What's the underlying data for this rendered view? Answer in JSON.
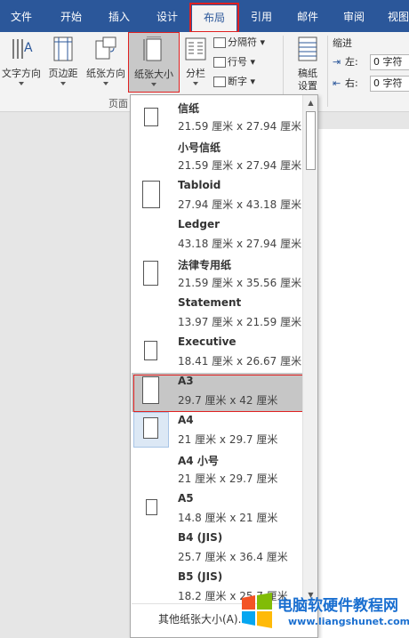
{
  "tabs": [
    "文件",
    "开始",
    "插入",
    "设计",
    "布局",
    "引用",
    "邮件",
    "审阅",
    "视图"
  ],
  "ribbon": {
    "text_direction": "文字方向",
    "margins": "页边距",
    "orientation": "纸张方向",
    "size": "纸张大小",
    "columns": "分栏",
    "breaks": "分隔符",
    "line_numbers": "行号",
    "hyphenation": "断字",
    "manuscript_line1": "稿纸",
    "manuscript_line2": "设置",
    "group_page_setup": "页面",
    "indent_title": "缩进",
    "indent_left_label": "左:",
    "indent_left_value": "0 字符",
    "indent_right_label": "右:",
    "indent_right_value": "0 字符"
  },
  "dropdown": {
    "items": [
      {
        "name": "信纸",
        "size": "21.59 厘米 x 27.94 厘米"
      },
      {
        "name": "小号信纸",
        "size": "21.59 厘米 x 27.94 厘米"
      },
      {
        "name": "Tabloid",
        "size": "27.94 厘米 x 43.18 厘米"
      },
      {
        "name": "Ledger",
        "size": "43.18 厘米 x 27.94 厘米"
      },
      {
        "name": "法律专用纸",
        "size": "21.59 厘米 x 35.56 厘米"
      },
      {
        "name": "Statement",
        "size": "13.97 厘米 x 21.59 厘米"
      },
      {
        "name": "Executive",
        "size": "18.41 厘米 x 26.67 厘米"
      },
      {
        "name": "A3",
        "size": "29.7 厘米 x 42 厘米"
      },
      {
        "name": "A4",
        "size": "21 厘米 x 29.7 厘米"
      },
      {
        "name": "A4 小号",
        "size": "21 厘米 x 29.7 厘米"
      },
      {
        "name": "A5",
        "size": "14.8 厘米 x 21 厘米"
      },
      {
        "name": "B4 (JIS)",
        "size": "25.7 厘米 x 36.4 厘米"
      },
      {
        "name": "B5 (JIS)",
        "size": "18.2 厘米 x 25.7 厘米"
      }
    ],
    "selected": "A3",
    "current": "A4",
    "more_label": "其他纸张大小(A)..."
  },
  "watermark": {
    "title": "电脑软硬件教程网",
    "url": "www.liangshunet.com"
  },
  "colors": {
    "ribbon_blue": "#2b579a",
    "highlight_red": "#e02020",
    "selected_gray": "#c6c6c6",
    "current_blue": "#dce8f5"
  }
}
